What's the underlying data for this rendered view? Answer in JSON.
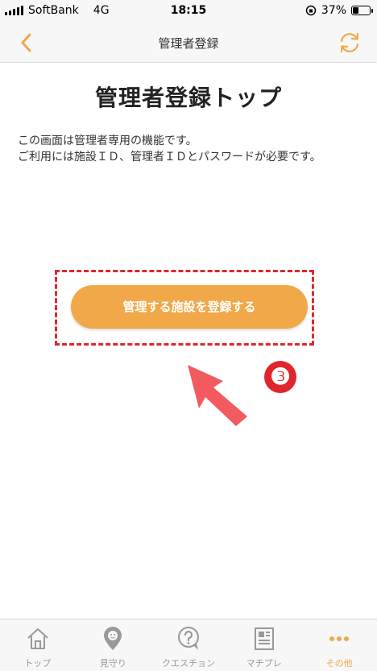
{
  "status_bar": {
    "carrier": "SoftBank",
    "network": "4G",
    "time": "18:15",
    "battery_percent": "37%",
    "battery_level": 0.37
  },
  "nav": {
    "title": "管理者登録",
    "back_icon": "chevron-left-icon",
    "refresh_icon": "refresh-icon"
  },
  "main": {
    "page_title": "管理者登録トップ",
    "description_line1": "この画面は管理者専用の機能です。",
    "description_line2": "ご利用には施設ＩＤ、管理者ＩＤとパスワードが必要です。",
    "register_button": "管理する施設を登録する",
    "step_marker": "❸"
  },
  "tabs": [
    {
      "label": "トップ",
      "icon": "home-icon"
    },
    {
      "label": "見守り",
      "icon": "location-pin-icon"
    },
    {
      "label": "クエスチョン",
      "icon": "question-bubble-icon"
    },
    {
      "label": "マチプレ",
      "icon": "newspaper-icon"
    },
    {
      "label": "その他",
      "icon": "more-dots-icon",
      "active": true
    }
  ],
  "colors": {
    "accent": "#f0a848",
    "highlight": "#e0262d",
    "arrow": "#f25a5f"
  }
}
